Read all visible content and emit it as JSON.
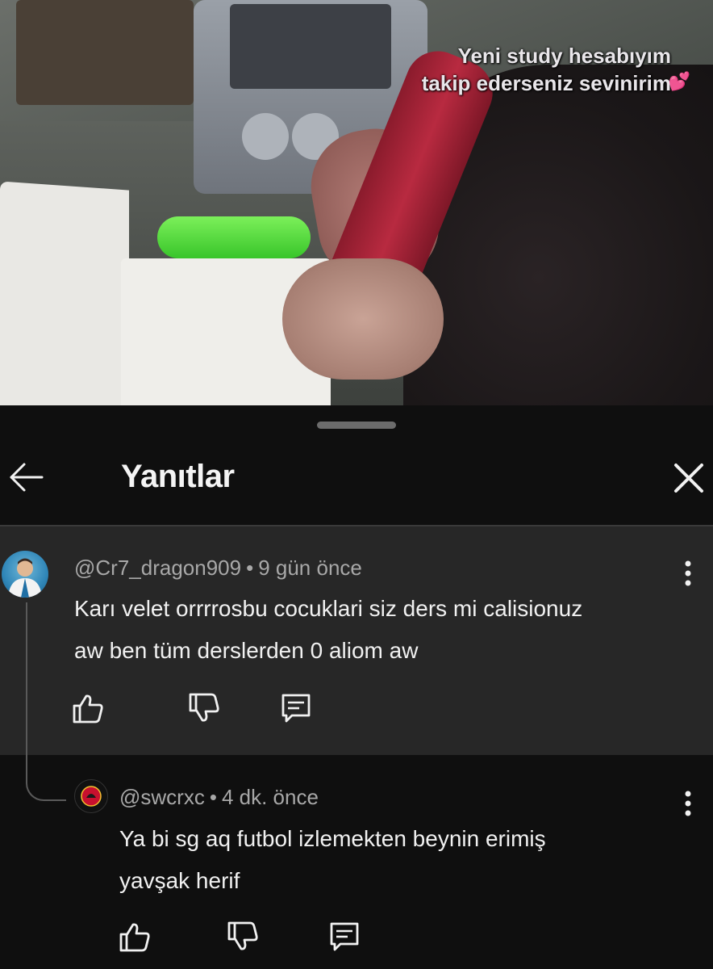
{
  "video": {
    "overlay_lines": [
      "Yeni study hesabıyım",
      "takip ederseniz sevinirim"
    ],
    "heart_icon": "pink-heart-icon"
  },
  "panel": {
    "title": "Yanıtlar",
    "back_icon": "arrow-left-icon",
    "close_icon": "close-icon"
  },
  "comments": [
    {
      "author": "@Cr7_dragon909",
      "separator": "•",
      "time": "9 gün önce",
      "lines": [
        "Karı velet orrrrosbu cocuklari siz ders mi calisionuz",
        "aw ben tüm derslerden 0 aliom aw"
      ],
      "avatar_icon": "profile-photo-avatar"
    },
    {
      "author": "@swcrxc",
      "separator": "•",
      "time": "4 dk. önce",
      "lines": [
        "Ya bi sg aq futbol izlemekten beynin erimiş",
        "yavşak herif"
      ],
      "avatar_icon": "club-crest-avatar"
    }
  ],
  "colors": {
    "background": "#0f0f0f",
    "parent_comment_bg": "#272727",
    "meta_text": "#a8a8a8",
    "text": "#f1f1f1"
  }
}
